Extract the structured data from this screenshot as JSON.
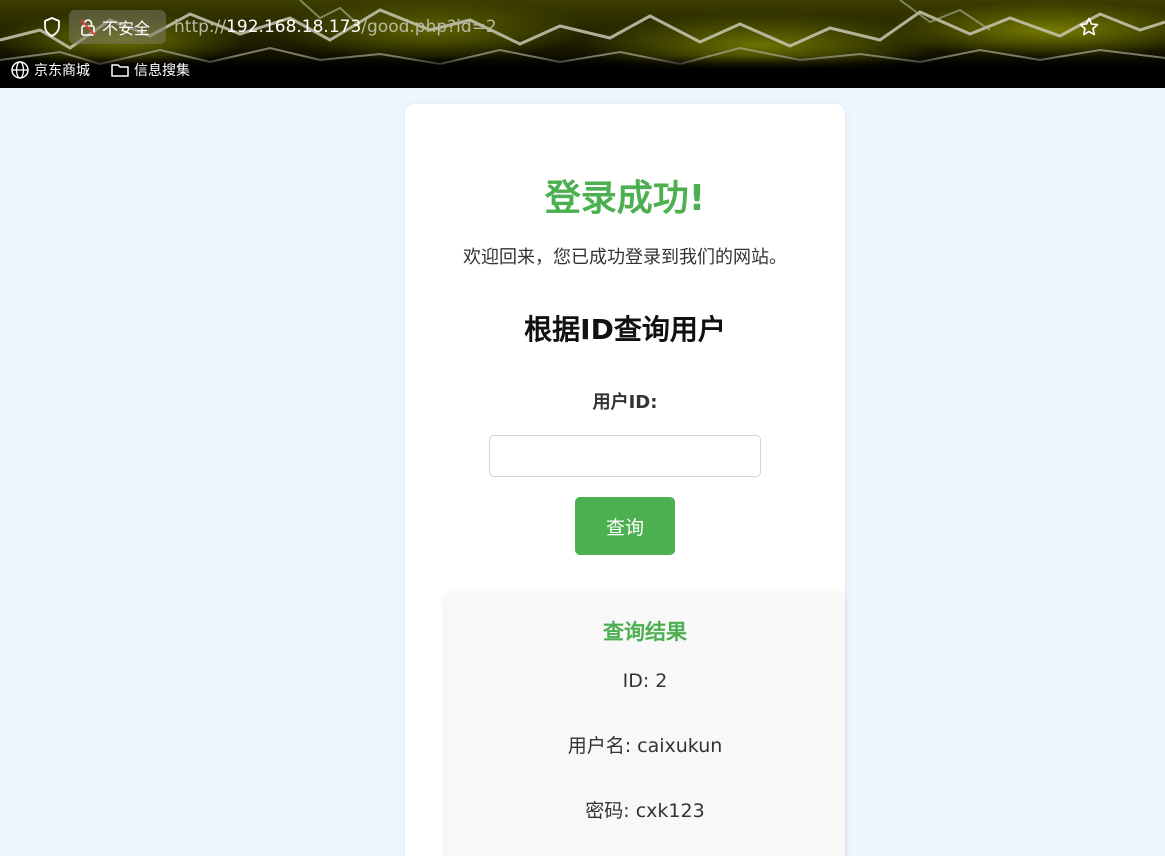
{
  "browser": {
    "security_label": "不安全",
    "url_scheme": "http://",
    "url_host": "192.168.18.173",
    "url_path": "/good.php?id=2",
    "bookmarks": [
      {
        "label": "京东商城",
        "icon": "globe-icon"
      },
      {
        "label": "信息搜集",
        "icon": "folder-icon"
      }
    ]
  },
  "page": {
    "success_title": "登录成功!",
    "welcome_text": "欢迎回来，您已成功登录到我们的网站。",
    "query_title": "根据ID查询用户",
    "field_label": "用户ID:",
    "input_value": "",
    "button_label": "查询",
    "result": {
      "title": "查询结果",
      "lines": [
        "ID: 2",
        "用户名: caixukun",
        "密码: cxk123"
      ]
    }
  },
  "colors": {
    "accent": "#4caf50",
    "page_bg": "#eef6ff"
  }
}
